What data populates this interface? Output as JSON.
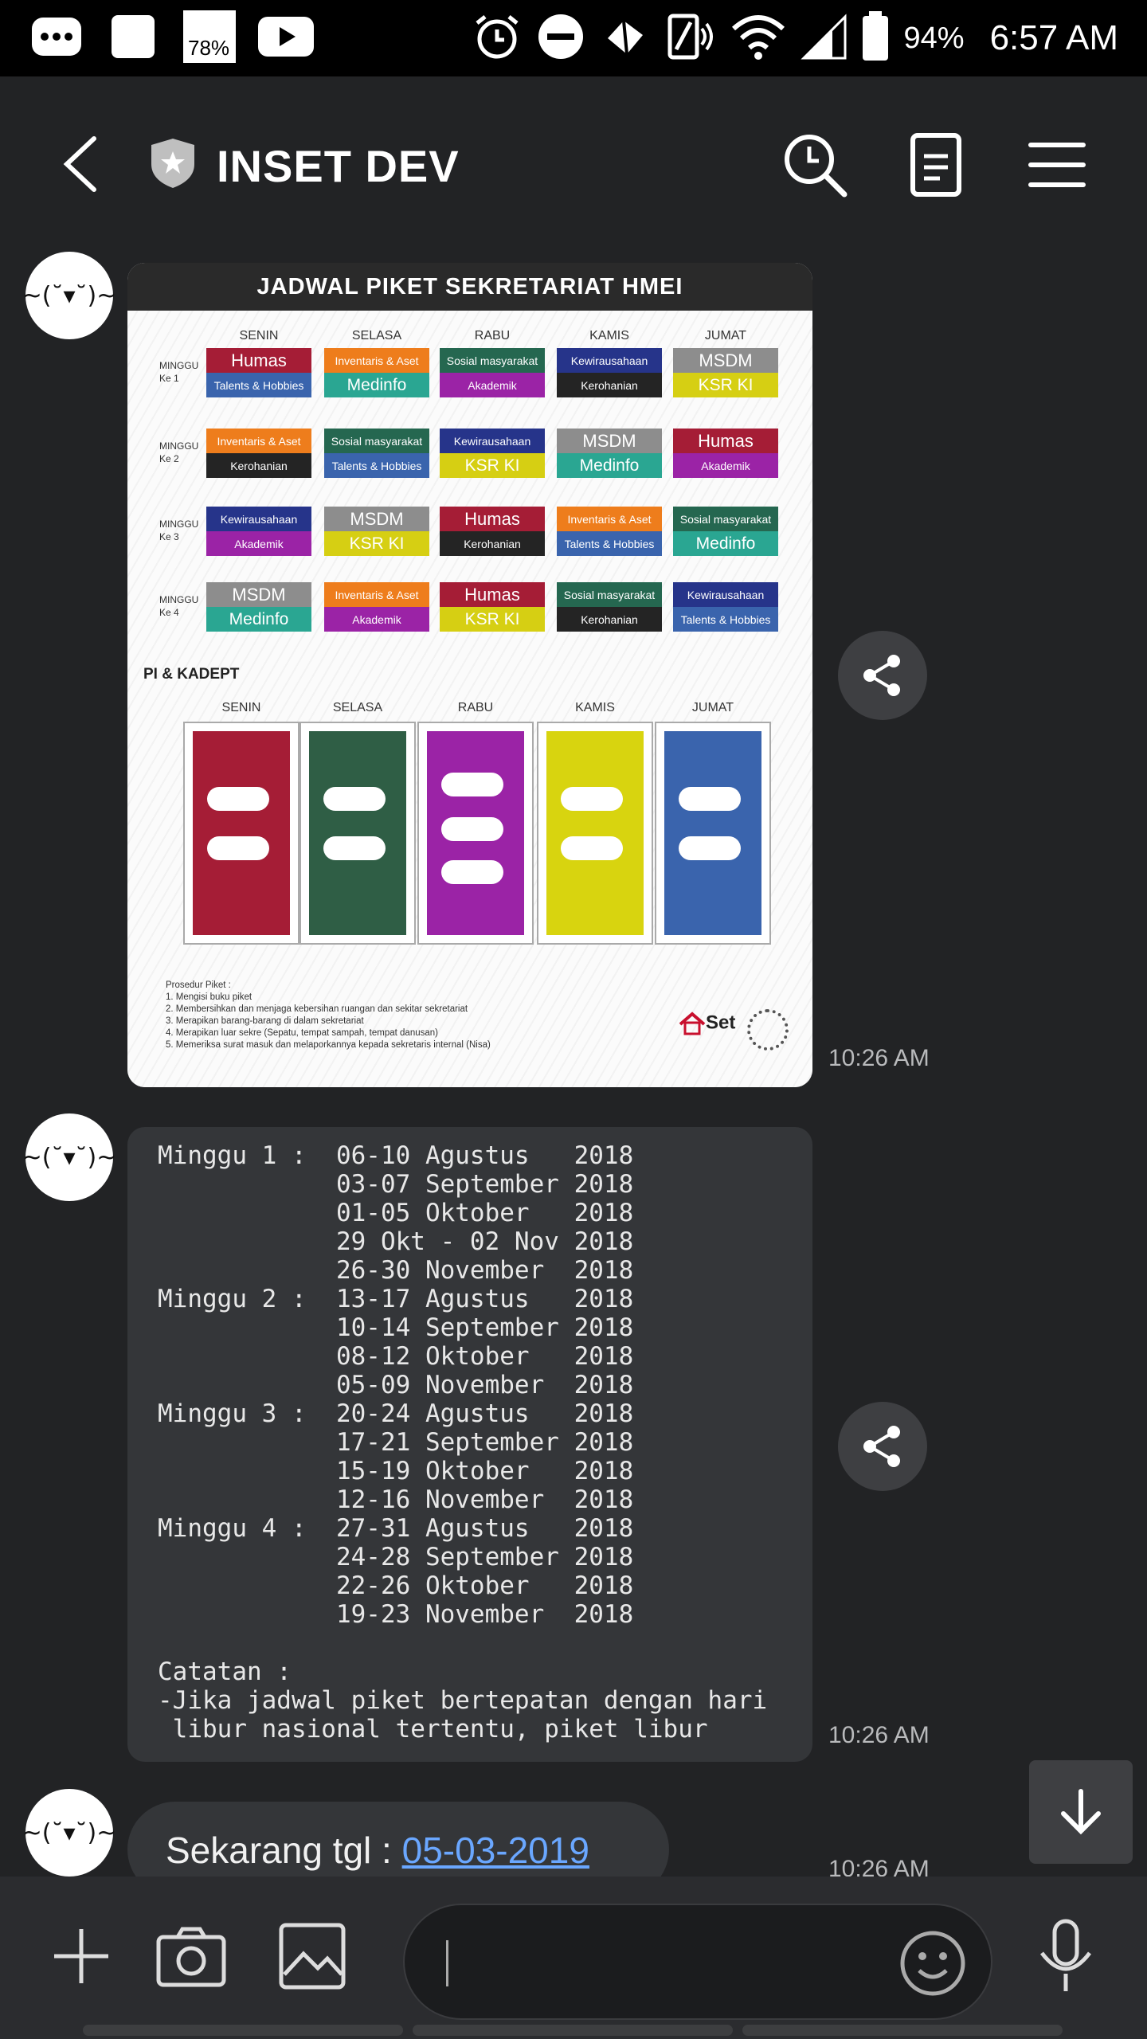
{
  "status_bar": {
    "left_icons": [
      "messages-icon",
      "white-square-icon",
      "gallery-icon",
      "youtube-icon"
    ],
    "gallery_badge": "78%",
    "battery": "94%",
    "time": "6:57 AM"
  },
  "header": {
    "title": "INSET DEV"
  },
  "messages": [
    {
      "avatar": "~(˘▾˘)~",
      "time": "10:26 AM",
      "poster": {
        "title": "JADWAL PIKET SEKRETARIAT HMEI",
        "days": [
          "SENIN",
          "SELASA",
          "RABU",
          "KAMIS",
          "JUMAT"
        ],
        "weeks": [
          {
            "label": "MINGGU\nKe 1",
            "cells": [
              [
                "Humas",
                "Talents & Hobbies"
              ],
              [
                "Inventaris & Aset",
                "Medinfo"
              ],
              [
                "Sosial masyarakat",
                "Akademik"
              ],
              [
                "Kewirausahaan",
                "Kerohanian"
              ],
              [
                "MSDM",
                "KSR KI"
              ]
            ]
          },
          {
            "label": "MINGGU\nKe 2",
            "cells": [
              [
                "Inventaris & Aset",
                "Kerohanian"
              ],
              [
                "Sosial masyarakat",
                "Talents & Hobbies"
              ],
              [
                "Kewirausahaan",
                "KSR KI"
              ],
              [
                "MSDM",
                "Medinfo"
              ],
              [
                "Humas",
                "Akademik"
              ]
            ]
          },
          {
            "label": "MINGGU\nKe 3",
            "cells": [
              [
                "Kewirausahaan",
                "Akademik"
              ],
              [
                "MSDM",
                "KSR KI"
              ],
              [
                "Humas",
                "Kerohanian"
              ],
              [
                "Inventaris & Aset",
                "Talents & Hobbies"
              ],
              [
                "Sosial masyarakat",
                "Medinfo"
              ]
            ]
          },
          {
            "label": "MINGGU\nKe 4",
            "cells": [
              [
                "MSDM",
                "Medinfo"
              ],
              [
                "Inventaris & Aset",
                "Akademik"
              ],
              [
                "Humas",
                "KSR KI"
              ],
              [
                "Sosial masyarakat",
                "Kerohanian"
              ],
              [
                "Kewirausahaan",
                "Talents & Hobbies"
              ]
            ]
          }
        ],
        "pi_title": "PI & KADEPT",
        "procedure": "Prosedur Piket :\n1. Mengisi buku piket\n2. Membersihkan dan menjaga kebersihan ruangan dan sekitar sekretariat\n3. Merapikan barang-barang di dalam sekretariat\n4. Merapikan luar sekre (Sepatu, tempat sampah, tempat danusan)\n5. Memeriksa surat masuk dan melaporkannya kepada sekretaris internal (Nisa)",
        "logo_text": "Set"
      }
    },
    {
      "avatar": "~(˘▾˘)~",
      "time": "10:26 AM",
      "text": "Minggu 1 :  06-10 Agustus   2018\n            03-07 September 2018\n            01-05 Oktober   2018\n            29 Okt - 02 Nov 2018\n            26-30 November  2018\nMinggu 2 :  13-17 Agustus   2018\n            10-14 September 2018\n            08-12 Oktober   2018\n            05-09 November  2018\nMinggu 3 :  20-24 Agustus   2018\n            17-21 September 2018\n            15-19 Oktober   2018\n            12-16 November  2018\nMinggu 4 :  27-31 Agustus   2018\n            24-28 September 2018\n            22-26 Oktober   2018\n            19-23 November  2018\n\nCatatan :\n-Jika jadwal piket bertepatan dengan hari\n libur nasional tertentu, piket libur"
    },
    {
      "avatar": "~(˘▾˘)~",
      "text_prefix": "Sekarang tgl : ",
      "link": "05-03-2019",
      "time": "10:26 AM"
    }
  ],
  "colors": {
    "Humas": "#a51d36",
    "Talents & Hobbies": "#3a64ad",
    "Inventaris & Aset": "#ee7d1c",
    "Medinfo": "#2aa692",
    "Sosial masyarakat": "#256750",
    "Akademik": "#9b23a6",
    "Kewirausahaan": "#26348a",
    "Kerohanian": "#242424",
    "MSDM": "#8d8d8d",
    "KSR KI": "#d6cf13",
    "pillars": [
      "#a51d36",
      "#2f5e45",
      "#9b23a6",
      "#d8d40f",
      "#3a64ad"
    ]
  }
}
